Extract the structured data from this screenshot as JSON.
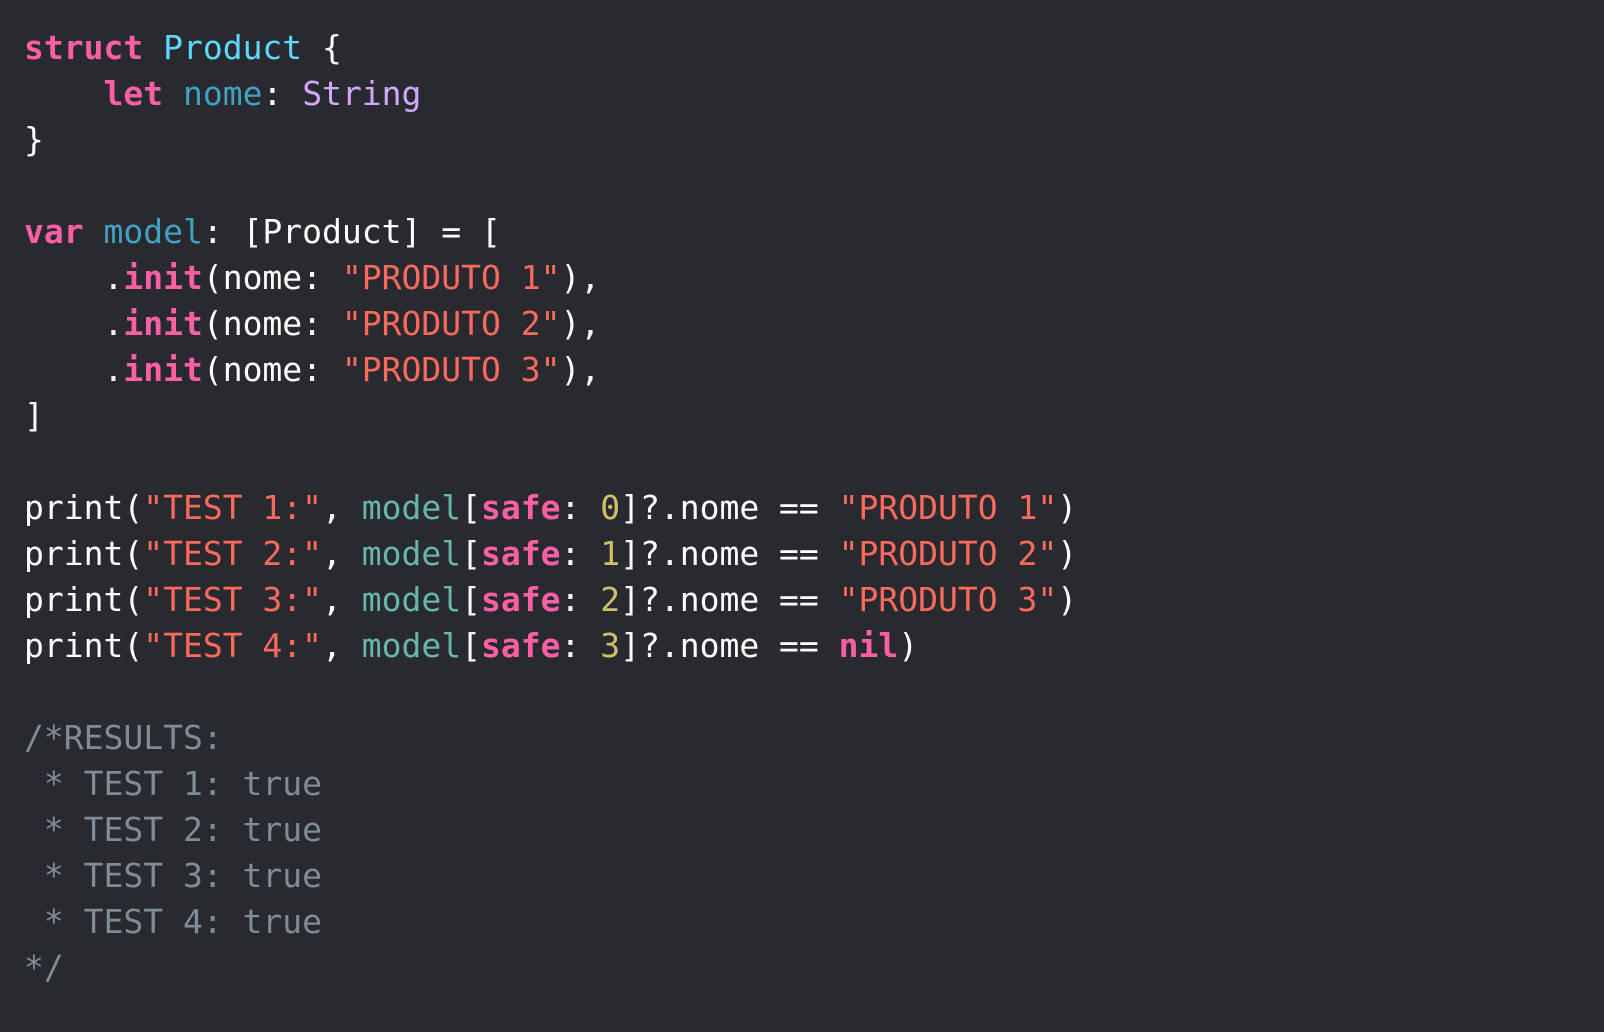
{
  "editor": {
    "background": "#292a30",
    "language": "Swift",
    "lines": [
      [
        [
          "keyword",
          "struct"
        ],
        [
          "plain",
          " "
        ],
        [
          "type-decl",
          "Product"
        ],
        [
          "plain",
          " {"
        ]
      ],
      [
        [
          "plain",
          "    "
        ],
        [
          "keyword",
          "let"
        ],
        [
          "plain",
          " "
        ],
        [
          "identifier",
          "nome"
        ],
        [
          "plain",
          ": "
        ],
        [
          "type",
          "String"
        ]
      ],
      [
        [
          "plain",
          "}"
        ]
      ],
      [],
      [
        [
          "keyword",
          "var"
        ],
        [
          "plain",
          " "
        ],
        [
          "identifier",
          "model"
        ],
        [
          "plain",
          ": [Product] = ["
        ]
      ],
      [
        [
          "plain",
          "    ."
        ],
        [
          "keyword",
          "init"
        ],
        [
          "plain",
          "(nome: "
        ],
        [
          "string",
          "\"PRODUTO 1\""
        ],
        [
          "plain",
          "),"
        ]
      ],
      [
        [
          "plain",
          "    ."
        ],
        [
          "keyword",
          "init"
        ],
        [
          "plain",
          "(nome: "
        ],
        [
          "string",
          "\"PRODUTO 2\""
        ],
        [
          "plain",
          "),"
        ]
      ],
      [
        [
          "plain",
          "    ."
        ],
        [
          "keyword",
          "init"
        ],
        [
          "plain",
          "(nome: "
        ],
        [
          "string",
          "\"PRODUTO 3\""
        ],
        [
          "plain",
          "),"
        ]
      ],
      [
        [
          "plain",
          "]"
        ]
      ],
      [],
      [
        [
          "plain",
          "print("
        ],
        [
          "string",
          "\"TEST 1:\""
        ],
        [
          "plain",
          ", "
        ],
        [
          "project-var",
          "model"
        ],
        [
          "plain",
          "["
        ],
        [
          "keyword",
          "safe"
        ],
        [
          "plain",
          ": "
        ],
        [
          "number",
          "0"
        ],
        [
          "plain",
          "]?.nome == "
        ],
        [
          "string",
          "\"PRODUTO 1\""
        ],
        [
          "plain",
          ")"
        ]
      ],
      [
        [
          "plain",
          "print("
        ],
        [
          "string",
          "\"TEST 2:\""
        ],
        [
          "plain",
          ", "
        ],
        [
          "project-var",
          "model"
        ],
        [
          "plain",
          "["
        ],
        [
          "keyword",
          "safe"
        ],
        [
          "plain",
          ": "
        ],
        [
          "number",
          "1"
        ],
        [
          "plain",
          "]?.nome == "
        ],
        [
          "string",
          "\"PRODUTO 2\""
        ],
        [
          "plain",
          ")"
        ]
      ],
      [
        [
          "plain",
          "print("
        ],
        [
          "string",
          "\"TEST 3:\""
        ],
        [
          "plain",
          ", "
        ],
        [
          "project-var",
          "model"
        ],
        [
          "plain",
          "["
        ],
        [
          "keyword",
          "safe"
        ],
        [
          "plain",
          ": "
        ],
        [
          "number",
          "2"
        ],
        [
          "plain",
          "]?.nome == "
        ],
        [
          "string",
          "\"PRODUTO 3\""
        ],
        [
          "plain",
          ")"
        ]
      ],
      [
        [
          "plain",
          "print("
        ],
        [
          "string",
          "\"TEST 4:\""
        ],
        [
          "plain",
          ", "
        ],
        [
          "project-var",
          "model"
        ],
        [
          "plain",
          "["
        ],
        [
          "keyword",
          "safe"
        ],
        [
          "plain",
          ": "
        ],
        [
          "number",
          "3"
        ],
        [
          "plain",
          "]?.nome == "
        ],
        [
          "keyword",
          "nil"
        ],
        [
          "plain",
          ")"
        ]
      ],
      [],
      [
        [
          "comment",
          "/*RESULTS:"
        ]
      ],
      [
        [
          "comment",
          " * TEST 1: true"
        ]
      ],
      [
        [
          "comment",
          " * TEST 2: true"
        ]
      ],
      [
        [
          "comment",
          " * TEST 3: true"
        ]
      ],
      [
        [
          "comment",
          " * TEST 4: true"
        ]
      ],
      [
        [
          "comment",
          "*/"
        ]
      ]
    ]
  },
  "colors": {
    "plain": "#ffffff",
    "keyword": "#fc5fa3",
    "type-decl": "#5dd8ff",
    "identifier": "#41a1c0",
    "type": "#d0a8ff",
    "string": "#fc6a5d",
    "number": "#d0bf69",
    "project-var": "#67b7a4",
    "comment": "#7f8c98"
  },
  "bold_kinds": [
    "keyword"
  ]
}
